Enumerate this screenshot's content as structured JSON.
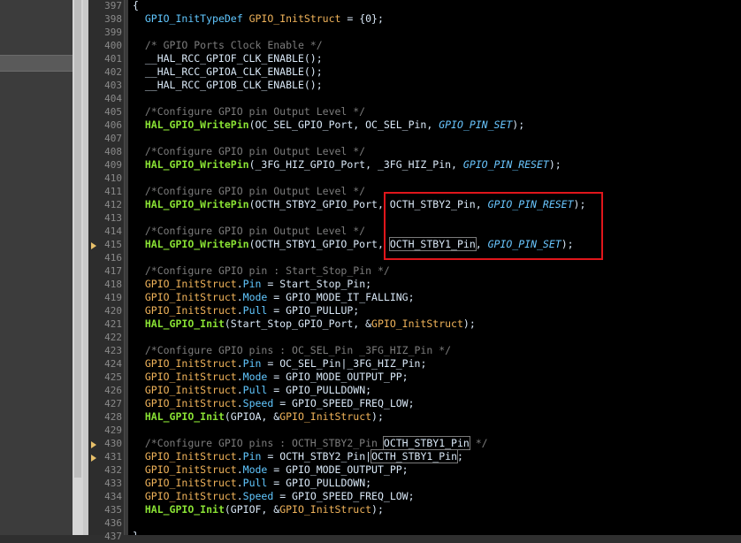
{
  "lines": [
    {
      "n": "397",
      "segs": [
        [
          "t",
          "{"
        ]
      ]
    },
    {
      "n": "398",
      "segs": [
        [
          "t",
          "  "
        ],
        [
          "ty",
          "GPIO_InitTypeDef"
        ],
        [
          "t",
          " "
        ],
        [
          "var",
          "GPIO_InitStruct"
        ],
        [
          "t",
          " = {0};"
        ]
      ]
    },
    {
      "n": "399",
      "segs": []
    },
    {
      "n": "400",
      "segs": [
        [
          "t",
          "  "
        ],
        [
          "c",
          "/* GPIO Ports Clock Enable */"
        ]
      ]
    },
    {
      "n": "401",
      "segs": [
        [
          "t",
          "  __HAL_RCC_GPIOF_CLK_ENABLE();"
        ]
      ]
    },
    {
      "n": "402",
      "segs": [
        [
          "t",
          "  __HAL_RCC_GPIOA_CLK_ENABLE();"
        ]
      ]
    },
    {
      "n": "403",
      "segs": [
        [
          "t",
          "  __HAL_RCC_GPIOB_CLK_ENABLE();"
        ]
      ]
    },
    {
      "n": "404",
      "segs": []
    },
    {
      "n": "405",
      "segs": [
        [
          "t",
          "  "
        ],
        [
          "c",
          "/*Configure GPIO pin Output Level */"
        ]
      ]
    },
    {
      "n": "406",
      "segs": [
        [
          "t",
          "  "
        ],
        [
          "fn",
          "HAL_GPIO_WritePin"
        ],
        [
          "t",
          "(OC_SEL_GPIO_Port, OC_SEL_Pin, "
        ],
        [
          "en",
          "GPIO_PIN_SET"
        ],
        [
          "t",
          ");"
        ]
      ]
    },
    {
      "n": "407",
      "segs": []
    },
    {
      "n": "408",
      "segs": [
        [
          "t",
          "  "
        ],
        [
          "c",
          "/*Configure GPIO pin Output Level */"
        ]
      ]
    },
    {
      "n": "409",
      "segs": [
        [
          "t",
          "  "
        ],
        [
          "fn",
          "HAL_GPIO_WritePin"
        ],
        [
          "t",
          "(_3FG_HIZ_GPIO_Port, _3FG_HIZ_Pin, "
        ],
        [
          "en",
          "GPIO_PIN_RESET"
        ],
        [
          "t",
          ");"
        ]
      ]
    },
    {
      "n": "410",
      "segs": []
    },
    {
      "n": "411",
      "segs": [
        [
          "t",
          "  "
        ],
        [
          "c",
          "/*Configure GPIO pin Output Level */"
        ]
      ]
    },
    {
      "n": "412",
      "segs": [
        [
          "t",
          "  "
        ],
        [
          "fn",
          "HAL_GPIO_WritePin"
        ],
        [
          "t",
          "(OCTH_STBY2_GPIO_Port, OCTH_STBY2_Pin, "
        ],
        [
          "en",
          "GPIO_PIN_RESET"
        ],
        [
          "t",
          ");"
        ]
      ]
    },
    {
      "n": "413",
      "segs": []
    },
    {
      "n": "414",
      "segs": [
        [
          "t",
          "  "
        ],
        [
          "c",
          "/*Configure GPIO pin Output Level */"
        ]
      ]
    },
    {
      "n": "415",
      "segs": [
        [
          "t",
          "  "
        ],
        [
          "fn",
          "HAL_GPIO_WritePin"
        ],
        [
          "t",
          "(OCTH_STBY1_GPIO_Port, "
        ],
        [
          "mark",
          "OCTH_STBY1_Pin"
        ],
        [
          "t",
          ", "
        ],
        [
          "en",
          "GPIO_PIN_SET"
        ],
        [
          "t",
          ");"
        ]
      ]
    },
    {
      "n": "416",
      "segs": []
    },
    {
      "n": "417",
      "segs": [
        [
          "t",
          "  "
        ],
        [
          "c",
          "/*Configure GPIO pin : Start_Stop_Pin */"
        ]
      ]
    },
    {
      "n": "418",
      "segs": [
        [
          "t",
          "  "
        ],
        [
          "var",
          "GPIO_InitStruct"
        ],
        [
          "t",
          "."
        ],
        [
          "fld",
          "Pin"
        ],
        [
          "t",
          " = Start_Stop_Pin;"
        ]
      ]
    },
    {
      "n": "419",
      "segs": [
        [
          "t",
          "  "
        ],
        [
          "var",
          "GPIO_InitStruct"
        ],
        [
          "t",
          "."
        ],
        [
          "fld",
          "Mode"
        ],
        [
          "t",
          " = GPIO_MODE_IT_FALLING;"
        ]
      ]
    },
    {
      "n": "420",
      "segs": [
        [
          "t",
          "  "
        ],
        [
          "var",
          "GPIO_InitStruct"
        ],
        [
          "t",
          "."
        ],
        [
          "fld",
          "Pull"
        ],
        [
          "t",
          " = GPIO_PULLUP;"
        ]
      ]
    },
    {
      "n": "421",
      "segs": [
        [
          "t",
          "  "
        ],
        [
          "fn",
          "HAL_GPIO_Init"
        ],
        [
          "t",
          "(Start_Stop_GPIO_Port, &"
        ],
        [
          "var",
          "GPIO_InitStruct"
        ],
        [
          "t",
          ");"
        ]
      ]
    },
    {
      "n": "422",
      "segs": []
    },
    {
      "n": "423",
      "segs": [
        [
          "t",
          "  "
        ],
        [
          "c",
          "/*Configure GPIO pins : OC_SEL_Pin _3FG_HIZ_Pin */"
        ]
      ]
    },
    {
      "n": "424",
      "segs": [
        [
          "t",
          "  "
        ],
        [
          "var",
          "GPIO_InitStruct"
        ],
        [
          "t",
          "."
        ],
        [
          "fld",
          "Pin"
        ],
        [
          "t",
          " = OC_SEL_Pin|_3FG_HIZ_Pin;"
        ]
      ]
    },
    {
      "n": "425",
      "segs": [
        [
          "t",
          "  "
        ],
        [
          "var",
          "GPIO_InitStruct"
        ],
        [
          "t",
          "."
        ],
        [
          "fld",
          "Mode"
        ],
        [
          "t",
          " = GPIO_MODE_OUTPUT_PP;"
        ]
      ]
    },
    {
      "n": "426",
      "segs": [
        [
          "t",
          "  "
        ],
        [
          "var",
          "GPIO_InitStruct"
        ],
        [
          "t",
          "."
        ],
        [
          "fld",
          "Pull"
        ],
        [
          "t",
          " = GPIO_PULLDOWN;"
        ]
      ]
    },
    {
      "n": "427",
      "segs": [
        [
          "t",
          "  "
        ],
        [
          "var",
          "GPIO_InitStruct"
        ],
        [
          "t",
          "."
        ],
        [
          "fld",
          "Speed"
        ],
        [
          "t",
          " = GPIO_SPEED_FREQ_LOW;"
        ]
      ]
    },
    {
      "n": "428",
      "segs": [
        [
          "t",
          "  "
        ],
        [
          "fn",
          "HAL_GPIO_Init"
        ],
        [
          "t",
          "(GPIOA, &"
        ],
        [
          "var",
          "GPIO_InitStruct"
        ],
        [
          "t",
          ");"
        ]
      ]
    },
    {
      "n": "429",
      "segs": []
    },
    {
      "n": "430",
      "segs": [
        [
          "t",
          "  "
        ],
        [
          "c",
          "/*Configure GPIO pins : OCTH_STBY2_Pin "
        ],
        [
          "mark",
          "OCTH_STBY1_Pin"
        ],
        [
          "c",
          " */"
        ]
      ]
    },
    {
      "n": "431",
      "segs": [
        [
          "t",
          "  "
        ],
        [
          "var",
          "GPIO_InitStruct"
        ],
        [
          "t",
          "."
        ],
        [
          "fld",
          "Pin"
        ],
        [
          "t",
          " = OCTH_STBY2_Pin|"
        ],
        [
          "mark",
          "OCTH_STBY1_Pin"
        ],
        [
          "t",
          ";"
        ]
      ]
    },
    {
      "n": "432",
      "segs": [
        [
          "t",
          "  "
        ],
        [
          "var",
          "GPIO_InitStruct"
        ],
        [
          "t",
          "."
        ],
        [
          "fld",
          "Mode"
        ],
        [
          "t",
          " = GPIO_MODE_OUTPUT_PP;"
        ]
      ]
    },
    {
      "n": "433",
      "segs": [
        [
          "t",
          "  "
        ],
        [
          "var",
          "GPIO_InitStruct"
        ],
        [
          "t",
          "."
        ],
        [
          "fld",
          "Pull"
        ],
        [
          "t",
          " = GPIO_PULLDOWN;"
        ]
      ]
    },
    {
      "n": "434",
      "segs": [
        [
          "t",
          "  "
        ],
        [
          "var",
          "GPIO_InitStruct"
        ],
        [
          "t",
          "."
        ],
        [
          "fld",
          "Speed"
        ],
        [
          "t",
          " = GPIO_SPEED_FREQ_LOW;"
        ]
      ]
    },
    {
      "n": "435",
      "segs": [
        [
          "t",
          "  "
        ],
        [
          "fn",
          "HAL_GPIO_Init"
        ],
        [
          "t",
          "(GPIOF, &"
        ],
        [
          "var",
          "GPIO_InitStruct"
        ],
        [
          "t",
          ");"
        ]
      ]
    },
    {
      "n": "436",
      "segs": []
    },
    {
      "n": "437",
      "segs": [
        [
          "t",
          "}"
        ]
      ]
    }
  ],
  "marker_lines": [
    "415",
    "430",
    "431"
  ]
}
